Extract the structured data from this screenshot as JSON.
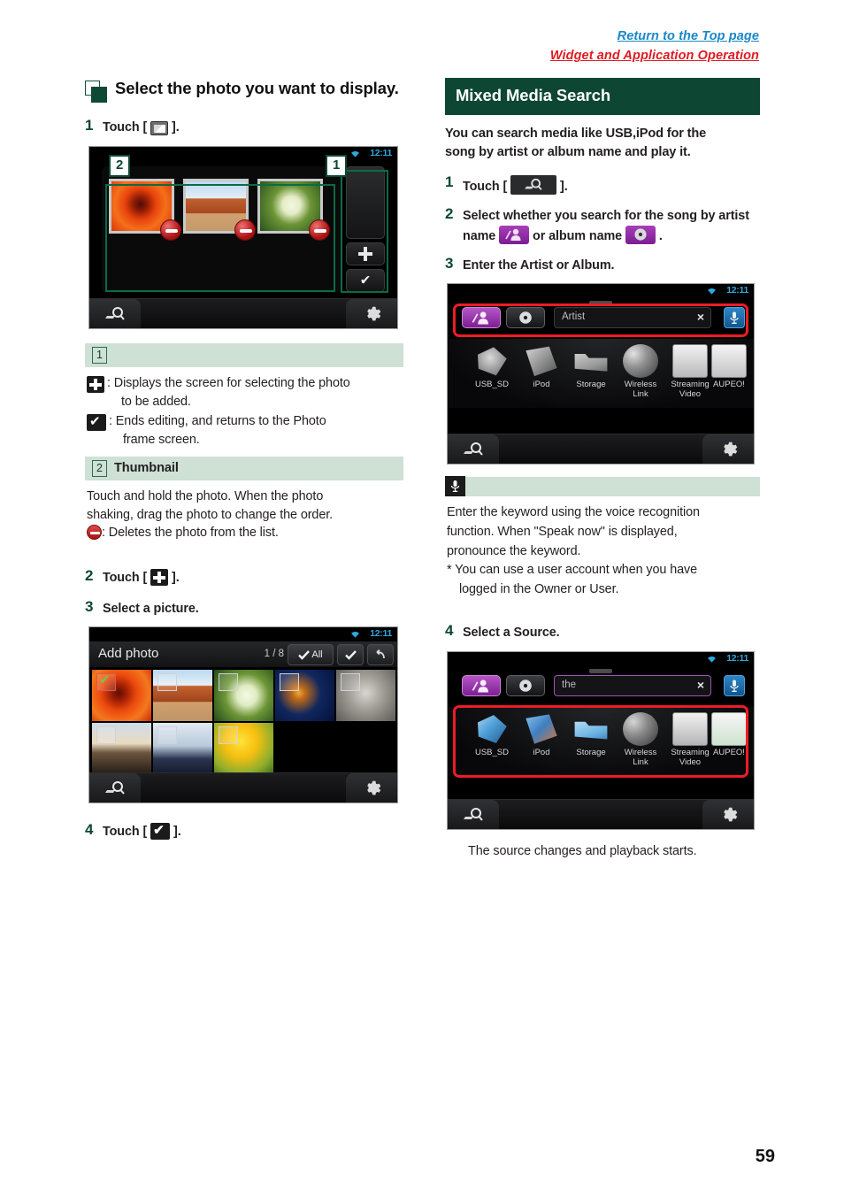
{
  "header": {
    "link_top": "Return to the Top page",
    "link_section": "Widget and Application Operation"
  },
  "left_column": {
    "heading": "Select the photo you want to display.",
    "steps": [
      {
        "num": "1",
        "text_before": "Touch [",
        "icon": "photo-edit-icon",
        "text_after": "]."
      },
      {
        "num": "2",
        "text_before": "Touch [",
        "icon": "plus-icon",
        "text_after": "]."
      },
      {
        "num": "3",
        "text_before": "Select a picture.",
        "icon": "",
        "text_after": ""
      },
      {
        "num": "4",
        "text_before": "Touch [",
        "icon": "check-icon",
        "text_after": "]."
      }
    ],
    "screenshot_edit": {
      "clock": "12:11",
      "callout_1": "1",
      "callout_2": "2",
      "thumbnails": [
        "red-dahlia-photo",
        "desert-butte-photo",
        "white-hydrangea-photo"
      ],
      "side_buttons": [
        "add-photo-plus",
        "confirm-check"
      ],
      "bottom_left_icon": "mixed-media-search-icon",
      "bottom_right_icon": "gear-icon"
    },
    "legend": {
      "item1_num": "1",
      "item1_label": "",
      "item1_line1": ": Displays the screen for selecting the photo",
      "item1_line1b": "to be added.",
      "item1_line2": ": Ends editing, and returns to the Photo",
      "item1_line2b": "frame screen.",
      "item2_num": "2",
      "item2_label": "Thumbnail",
      "item2_line1": "Touch and hold the photo. When the photo",
      "item2_line2": "shaking, drag the photo to change the order.",
      "item2_line3": ": Deletes the photo from the list."
    },
    "screenshot_addphoto": {
      "clock": "12:11",
      "title": "Add photo",
      "count": "1 / 8",
      "btn_all": "All",
      "btn_ok": "✔",
      "btn_back": "↶",
      "photos": [
        "red-dahlia-photo",
        "desert-butte-photo",
        "white-hydrangea-photo",
        "blue-glass-photo",
        "koala-photo",
        "lighthouse-sunset-photo",
        "penguins-photo",
        "yellow-tulips-photo"
      ],
      "selected_index": 0,
      "bottom_left_icon": "mixed-media-search-icon",
      "bottom_right_icon": "gear-icon"
    }
  },
  "right_column": {
    "section_title": "Mixed Media Search",
    "lead_line1": "You can search media like USB,iPod for the",
    "lead_line2": "song by artist or album name and play it.",
    "steps": [
      {
        "num": "1",
        "text_before": "Touch [",
        "icon": "mixed-media-search-icon",
        "text_after": "]."
      },
      {
        "num": "2",
        "part1": "Select whether you search for the song",
        "part2": "by artist name",
        "icon_artist": "artist-icon",
        "part3": "or album name",
        "icon_album": "album-icon",
        "part4": "."
      },
      {
        "num": "3",
        "text_before": "Enter the Artist or Album.",
        "icon": "",
        "text_after": ""
      },
      {
        "num": "4",
        "text_before": "Select a Source.",
        "icon": "",
        "text_after": ""
      }
    ],
    "screenshot_search": {
      "clock": "12:11",
      "tab_artist": "artist-icon",
      "tab_album": "album-icon",
      "field_placeholder": "Artist",
      "field_value": "",
      "clear_label": "×",
      "mic_icon": "microphone-icon",
      "sources": [
        "USB_SD",
        "iPod",
        "Storage",
        "Wireless Link",
        "Streaming Video",
        "AUPEO!"
      ],
      "highlight": "search-bar-highlight",
      "bottom_left_icon": "mixed-media-search-icon",
      "bottom_right_icon": "gear-icon"
    },
    "note": {
      "head_icon": "microphone-icon",
      "line1": "Enter the keyword using the voice recognition",
      "line2": "function. When \"Speak now\" is displayed,",
      "line3": "pronounce the keyword.",
      "line4": "* You can use a user account when you have",
      "line5": "logged in the Owner or User."
    },
    "screenshot_source": {
      "clock": "12:11",
      "tab_artist": "artist-icon",
      "tab_album": "album-icon",
      "field_value": "the",
      "clear_label": "×",
      "mic_icon": "microphone-icon",
      "sources": [
        "USB_SD",
        "iPod",
        "Storage",
        "Wireless Link",
        "Streaming Video",
        "AUPEO!"
      ],
      "highlight": "source-row-highlight",
      "bottom_left_icon": "mixed-media-search-icon",
      "bottom_right_icon": "gear-icon"
    },
    "closing": "The source changes and playback starts."
  },
  "footer": {
    "page_number": "59"
  },
  "colors": {
    "accent_green": "#0d4734",
    "link_blue": "#1a87c8",
    "link_red": "#e01b22",
    "highlight_red": "#ed1c24",
    "legend_bg": "#cfe0d5",
    "purple": "#8f2aa6",
    "mic_blue": "#2f86c6"
  }
}
